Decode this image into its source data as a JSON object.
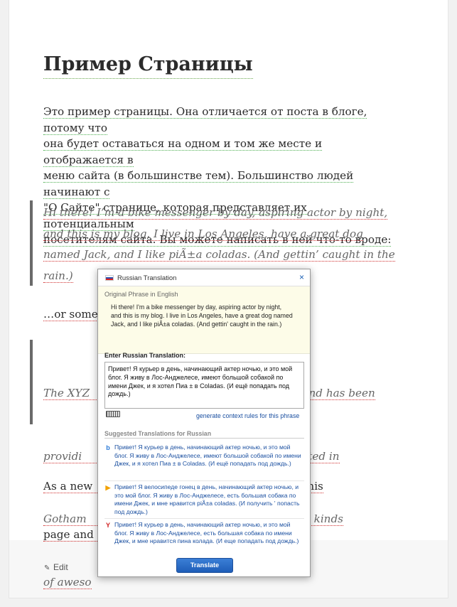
{
  "page": {
    "title": "Пример Страницы",
    "intro_lines": [
      "Это пример страницы. Она отличается от поста в блоге, потому что",
      "она будет оставаться на одном и том же месте и отображается в",
      "меню сайта (в большинстве тем). Большинство людей начинают с",
      "\"О Сайте\" странице, которая представляет их потенциальным",
      "посетителям сайта. Вы можете написать в ней что-то вроде:"
    ],
    "quote1_lines": [
      "Hi there! I’m a bike messenger by day, aspiring actor by night,",
      "and this is my blog. I live in Los Angeles, have a great dog",
      "named Jack, and I like piÃ±a coladas. (And gettin’ caught in the",
      "rain.)"
    ],
    "or_something": "…or some",
    "quote2_lines": [
      "The XYZ                                                    1971, and has been",
      "providi                                                since. Located in",
      "Gotham                                                  d does all kinds",
      "of aweso"
    ],
    "outro_lines": [
      "As a new                                    board to delete this",
      "page and                                               !"
    ],
    "edit_label": "Edit"
  },
  "popup": {
    "title": "Russian Translation",
    "close_label": "×",
    "original_label": "Original Phrase in English",
    "original_text_lines": [
      "Hi there! I'm a bike messenger by day, aspiring actor by night,",
      "and this is my blog. I live in Los Angeles, have a great dog named",
      "Jack, and I like piÃ±a coladas. (And gettin' caught in the rain.)"
    ],
    "enter_label": "Enter Russian Translation:",
    "translation_value": "Привет! Я курьер в день, начинающий актер ночью, и это мой блог. Я живу в Лос-Анджелесе, имеют большой собакой по имени Джек, и я хотел Пиа ± в Coladas. (И ещё попадать под дождь.)",
    "context_link": "generate context rules for this phrase",
    "suggested_label": "Suggested Translations for Russian",
    "suggestions": [
      {
        "engine": "bing",
        "text": "Привет! Я курьер в день, начинающий актер ночью, и это мой блог. Я живу в Лос-Анджелесе, имеют большой собакой по имени Джек, и я хотел Пиа ± в Coladas. (И ещё попадать под дождь.)"
      },
      {
        "engine": "google",
        "text": "Привет! Я велосипеде гонец в день, начинающий актер ночью, и это мой блог. Я живу в Лос-Анджелесе, есть большая собака по имени Джек, и мне нравится piÃ±a coladas. (И получить ' попасть под дождь.)"
      },
      {
        "engine": "yandex",
        "text": "Привет! Я курьер в день, начинающий актер ночью, и это мой блог. Я живу в Лос-Анджелесе, есть большая собака по имени Джек, и мне нравится пина колада. (И еще попадать под дождь.)"
      }
    ],
    "translate_button": "Translate"
  },
  "colors": {
    "translate_button": "#1e5db8",
    "link": "#1a4fa0",
    "underline_green": "#4caf50",
    "underline_red": "#d03030"
  }
}
